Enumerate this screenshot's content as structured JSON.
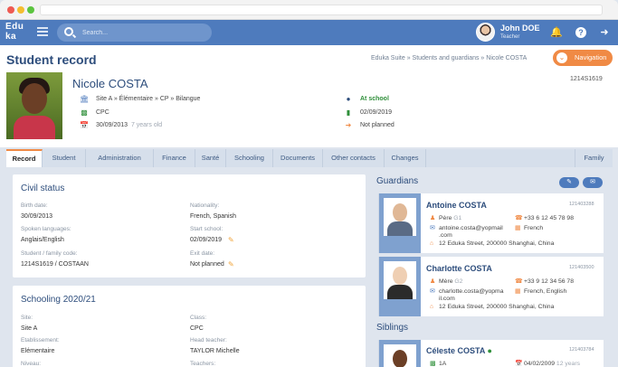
{
  "app": {
    "logo_top": "Edu",
    "logo_bottom": "ka"
  },
  "search": {
    "placeholder": "Search..."
  },
  "user": {
    "name": "John DOE",
    "role": "Teacher"
  },
  "page": {
    "title": "Student record",
    "breadcrumb": "Eduka Suite » Students and guardians » Nicole COSTA",
    "nav_button": "Navigation"
  },
  "student": {
    "name": "Nicole COSTA",
    "id": "1214S1619",
    "path": "Site A » Élémentaire » CP » Bilangue",
    "class": "CPC",
    "birth": "30/09/2013",
    "age": "7 years old",
    "status": "At school",
    "entry": "02/09/2019",
    "exit": "Not planned"
  },
  "tabs": [
    "Record",
    "Student",
    "Administration",
    "Finance",
    "Santé",
    "Schooling",
    "Documents",
    "Other contacts",
    "Changes",
    "Family"
  ],
  "civil": {
    "title": "Civil status",
    "birth_date_label": "Birth date:",
    "birth_date": "30/09/2013",
    "nationality_label": "Nationality:",
    "nationality": "French, Spanish",
    "spoken_label": "Spoken languages:",
    "spoken": "Anglais/English",
    "start_label": "Start school:",
    "start": "02/09/2019",
    "code_label": "Student / family code:",
    "code": "1214S1619 / COSTAAN",
    "exit_label": "Exit date:",
    "exit": "Not planned"
  },
  "schooling": {
    "title": "Schooling 2020/21",
    "site_label": "Site:",
    "site": "Site A",
    "class_label": "Class:",
    "class": "CPC",
    "estab_label": "Etablissement:",
    "estab": "Elémentaire",
    "head_label": "Head teacher:",
    "head": "TAYLOR Michelle",
    "level_label": "Niveau:",
    "teachers_label": "Teachers:"
  },
  "guardians": {
    "title": "Guardians",
    "items": [
      {
        "name": "Antoine COSTA",
        "id": "121403288",
        "relation": "Père",
        "rank": "G1",
        "phone": "+33 6 12 45 78 98",
        "email_1": "antoine.costa@yopmail",
        "email_2": ".com",
        "language": "French",
        "address": "12 Eduka Street, 200000 Shanghai, China"
      },
      {
        "name": "Charlotte COSTA",
        "id": "121403500",
        "relation": "Mère",
        "rank": "G2",
        "phone": "+33 9 12 34 56 78",
        "email_1": "charlotte.costa@yopma",
        "email_2": "il.com",
        "language": "French, English",
        "address": "12 Eduka Street, 200000 Shanghai, China"
      }
    ]
  },
  "siblings": {
    "title": "Siblings",
    "items": [
      {
        "name": "Céleste COSTA",
        "id": "121403784",
        "class": "1A",
        "birth": "04/02/2009",
        "age": "12 years"
      }
    ]
  },
  "colors": {
    "primary": "#4e7bbd",
    "accent": "#f08a45",
    "title": "#2d4d7c"
  }
}
